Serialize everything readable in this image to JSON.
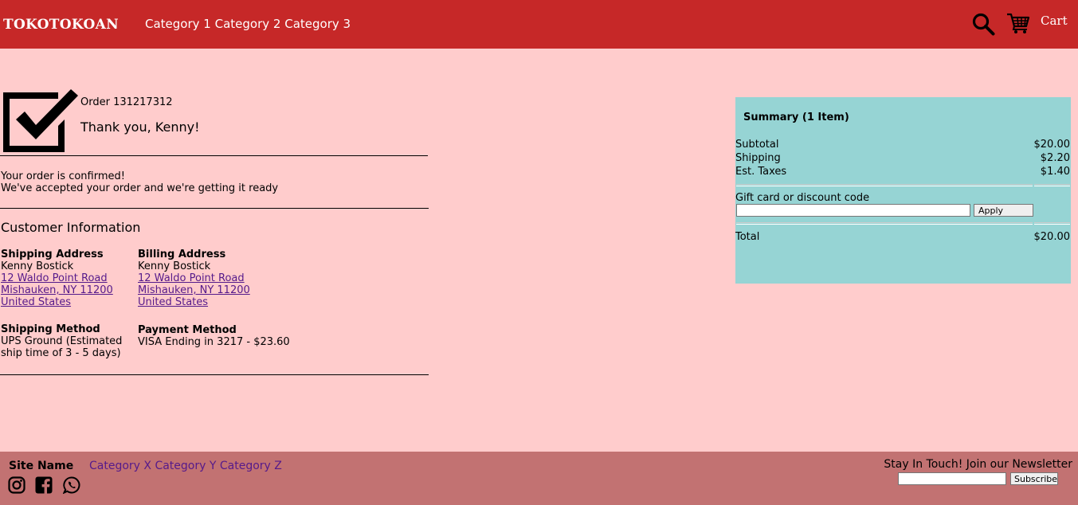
{
  "header": {
    "brand": "TOKOTOKOAN",
    "nav": [
      "Category 1",
      "Category 2",
      "Category 3"
    ],
    "search_icon": "search-icon",
    "cart_icon": "cart-icon",
    "cart_label": "Cart",
    "bg_color": "#c62828"
  },
  "confirmation": {
    "check_icon": "checkbox-checked-icon",
    "order_label": "Order 131217312",
    "thanks": "Thank you, Kenny!",
    "confirmed_line1": "Your order is confirmed!",
    "confirmed_line2": "We've accepted your order and we're getting it ready"
  },
  "customer": {
    "title": "Customer Information",
    "shipping_address": {
      "heading": "Shipping Address",
      "name": "Kenny Bostick",
      "street": "12 Waldo Point Road",
      "city": "Mishauken, NY 11200",
      "country": "United States"
    },
    "billing_address": {
      "heading": "Billing Address",
      "name": "Kenny Bostick",
      "street": "12 Waldo Point Road",
      "city": "Mishauken, NY 11200",
      "country": "United States"
    },
    "shipping_method": {
      "heading": "Shipping Method",
      "line1": "UPS Ground (Estimated",
      "line2": "ship time of 3 - 5 days)"
    },
    "payment_method": {
      "heading": "Payment Method",
      "detail": "VISA Ending in 3217 - $23.60"
    }
  },
  "summary": {
    "title": "Summary (1 Item)",
    "subtotal_label": "Subtotal",
    "subtotal_value": "$20.00",
    "shipping_label": "Shipping",
    "shipping_value": "$2.20",
    "taxes_label": "Est. Taxes",
    "taxes_value": "$1.40",
    "gift_label": "Gift card or discount code",
    "gift_value": "",
    "apply_label": "Apply",
    "total_label": "Total",
    "total_value": "$20.00",
    "bg_color": "#96d4d4"
  },
  "footer": {
    "site_name": "Site Name",
    "nav": [
      "Category X",
      "Category Y",
      "Category Z"
    ],
    "social_icons": [
      "instagram-icon",
      "facebook-icon",
      "whatsapp-icon"
    ],
    "newsletter_label": "Stay In Touch! Join our Newsletter",
    "newsletter_value": "",
    "subscribe_label": "Subscribe",
    "bg_color": "#c27272"
  },
  "colors": {
    "page_bg": "#ffcccc",
    "link": "#551a8b"
  }
}
